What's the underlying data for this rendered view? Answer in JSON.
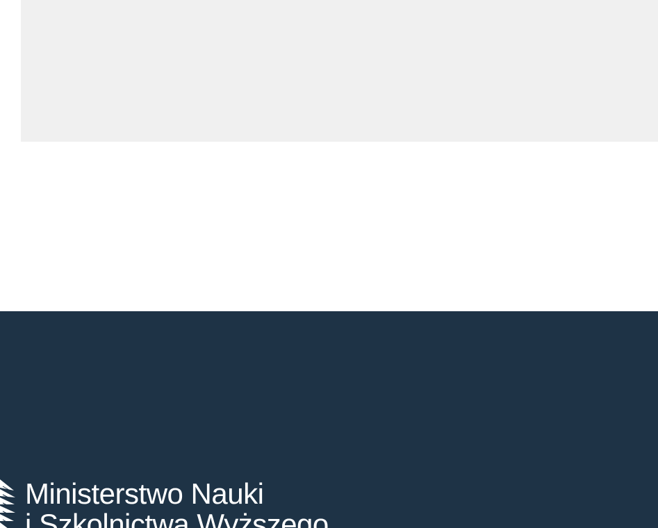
{
  "footer": {
    "logo": {
      "icon": "eagle-emblem-icon",
      "line1": "Ministerstwo Nauki",
      "line2": "i Szkolnictwa Wyższego"
    }
  },
  "colors": {
    "placeholder": "#f0f0f0",
    "footer_background": "#1e3346",
    "logo_text": "#ffffff"
  }
}
